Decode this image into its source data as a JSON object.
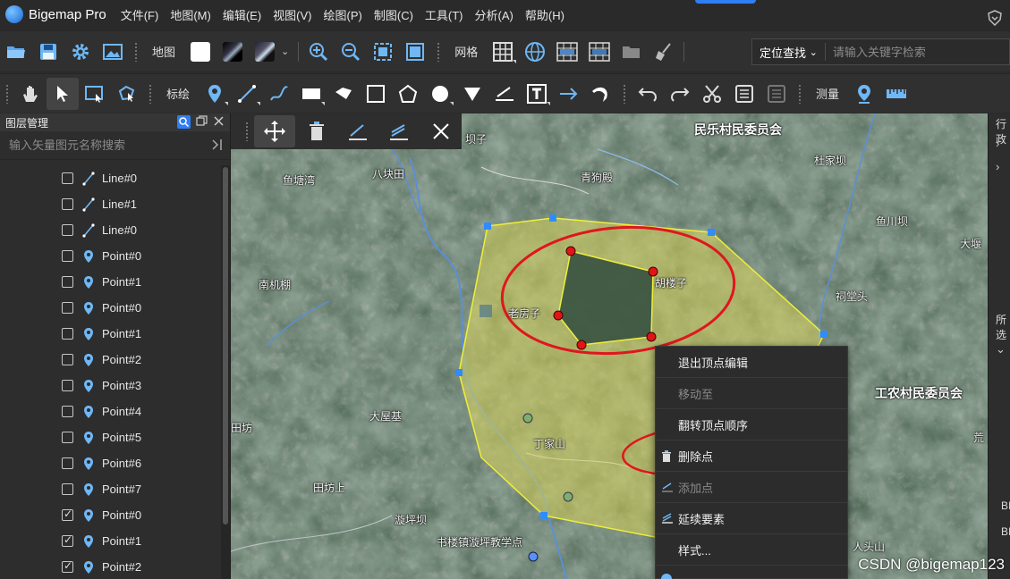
{
  "app": {
    "title": "Bigemap Pro",
    "menu": [
      "文件(F)",
      "地图(M)",
      "编辑(E)",
      "视图(V)",
      "绘图(P)",
      "制图(C)",
      "工具(T)",
      "分析(A)",
      "帮助(H)"
    ]
  },
  "toolbar1": {
    "map_label": "地图",
    "grid_label": "网格",
    "locate_label": "定位查找",
    "search_placeholder": "请输入关键字检索"
  },
  "toolbar2": {
    "draw_label": "标绘",
    "measure_label": "测量"
  },
  "layer_panel": {
    "title": "图层管理",
    "filter_placeholder": "输入矢量图元名称搜索",
    "items": [
      {
        "label": "Line#0",
        "type": "line",
        "checked": false
      },
      {
        "label": "Line#1",
        "type": "line",
        "checked": false
      },
      {
        "label": "Line#0",
        "type": "line",
        "checked": false
      },
      {
        "label": "Point#0",
        "type": "point",
        "checked": false
      },
      {
        "label": "Point#1",
        "type": "point",
        "checked": false
      },
      {
        "label": "Point#0",
        "type": "point",
        "checked": false
      },
      {
        "label": "Point#1",
        "type": "point",
        "checked": false
      },
      {
        "label": "Point#2",
        "type": "point",
        "checked": false
      },
      {
        "label": "Point#3",
        "type": "point",
        "checked": false
      },
      {
        "label": "Point#4",
        "type": "point",
        "checked": false
      },
      {
        "label": "Point#5",
        "type": "point",
        "checked": false
      },
      {
        "label": "Point#6",
        "type": "point",
        "checked": false
      },
      {
        "label": "Point#7",
        "type": "point",
        "checked": false
      },
      {
        "label": "Point#0",
        "type": "point",
        "checked": true
      },
      {
        "label": "Point#1",
        "type": "point",
        "checked": true
      },
      {
        "label": "Point#2",
        "type": "point",
        "checked": true
      }
    ]
  },
  "map": {
    "places": {
      "p1": "坝子",
      "p2": "民乐村民委员会",
      "p3": "八块田",
      "p4": "鱼塘湾",
      "p5": "青狗殿",
      "p6": "杜家坝",
      "p7": "鱼川坝",
      "p8": "大堰",
      "p9": "南机棚",
      "p10": "老房子",
      "p11": "胡楼子",
      "p12": "祠堂头",
      "p13": "工农村民委员会",
      "p14": "大屋基",
      "p15": "丁家山",
      "p16": "田坊",
      "p17": "田坊上",
      "p18": "漩坪坝",
      "p19": "书楼镇漩坪教学点",
      "p20": "人头山",
      "p21": "荒"
    }
  },
  "context_menu": {
    "items": [
      {
        "label": "退出顶点编辑",
        "disabled": false
      },
      {
        "label": "移动至",
        "disabled": true
      },
      {
        "label": "翻转顶点顺序",
        "disabled": false
      },
      {
        "label": "删除点",
        "disabled": false
      },
      {
        "label": "添加点",
        "disabled": true
      },
      {
        "label": "延续要素",
        "disabled": false
      },
      {
        "label": "样式...",
        "disabled": false
      }
    ]
  },
  "right_panel": {
    "label_top": "行政",
    "label_mid": "所选",
    "text_bi1": "BI",
    "text_bi2": "BI"
  },
  "watermark": "CSDN @bigemap123",
  "colors": {
    "accent": "#2f7ef5",
    "polygon_fill": "#d8d35a",
    "polygon_stroke": "#f0ee3c",
    "annotation_red": "#e0161d",
    "vertex_blue": "#2f8cff",
    "vertex_red": "#e01515"
  }
}
